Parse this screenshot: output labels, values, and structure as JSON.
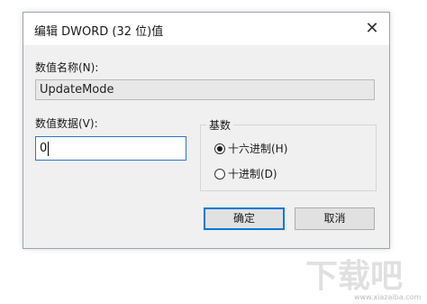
{
  "window": {
    "title": "编辑 DWORD (32 位)值",
    "close_glyph": "✕"
  },
  "value_name": {
    "label": "数值名称(N):",
    "value": "UpdateMode"
  },
  "value_data": {
    "label": "数值数据(V):",
    "value": "0"
  },
  "base": {
    "legend": "基数",
    "options": [
      {
        "label": "十六进制(H)",
        "checked": true
      },
      {
        "label": "十进制(D)",
        "checked": false
      }
    ]
  },
  "buttons": {
    "ok_label": "确定",
    "cancel_label": "取消"
  },
  "watermark": {
    "text": "下载吧",
    "url": "www.xiazaiba.com"
  },
  "colors": {
    "dialog_bg": "#f0f0f0",
    "accent": "#0078d7",
    "input_border_focus": "#2f73c8"
  }
}
